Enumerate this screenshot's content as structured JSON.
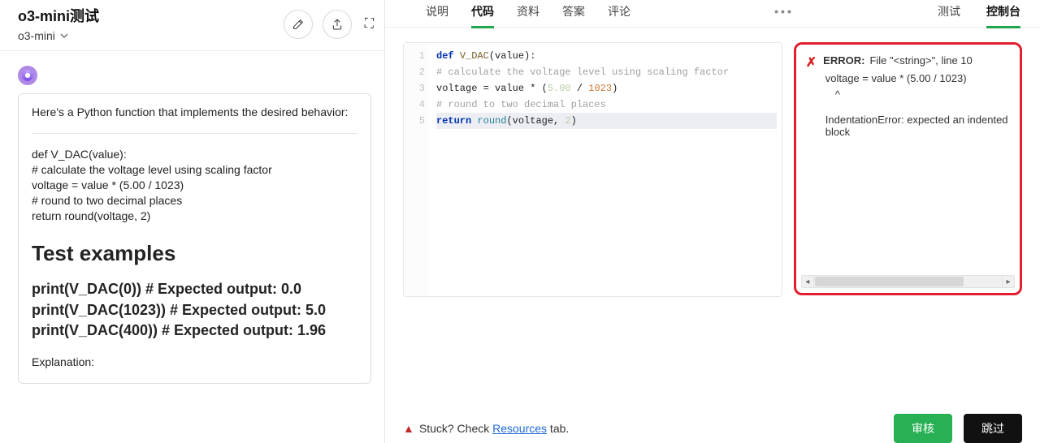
{
  "left": {
    "title": "o3-mini测试",
    "subtitle": "o3-mini",
    "card_intro": "Here's a Python function that implements the desired behavior:",
    "card_code": "def V_DAC(value):\n# calculate the voltage level using scaling factor\nvoltage = value * (5.00 / 1023)\n# round to two decimal places\nreturn round(voltage, 2)",
    "section_heading": "Test examples",
    "examples": "print(V_DAC(0)) # Expected output: 0.0\nprint(V_DAC(1023)) # Expected output: 5.0\nprint(V_DAC(400)) # Expected output: 1.96",
    "more": "Explanation:"
  },
  "tabs_left": {
    "items": [
      "说明",
      "代码",
      "资料",
      "答案",
      "评论"
    ],
    "active": 1
  },
  "tabs_right": {
    "items": [
      "测试",
      "控制台"
    ],
    "active": 1
  },
  "editor": {
    "lines": [
      {
        "n": 1,
        "seg": [
          [
            "kw",
            "def "
          ],
          [
            "fn",
            "V_DAC"
          ],
          [
            "pln",
            "(value):"
          ]
        ]
      },
      {
        "n": 2,
        "seg": [
          [
            "com",
            "# calculate the voltage level using scaling factor"
          ]
        ]
      },
      {
        "n": 3,
        "seg": [
          [
            "pln",
            "voltage = value * ("
          ],
          [
            "num",
            "5.00"
          ],
          [
            "pln",
            " / "
          ],
          [
            "num2",
            "1023"
          ],
          [
            "pln",
            ")"
          ]
        ]
      },
      {
        "n": 4,
        "seg": [
          [
            "com",
            "# round to two decimal places"
          ]
        ]
      },
      {
        "n": 5,
        "seg": [
          [
            "kw",
            "return "
          ],
          [
            "fn2",
            "round"
          ],
          [
            "pln",
            "(voltage, "
          ],
          [
            "num",
            "2"
          ],
          [
            "pln",
            ")"
          ]
        ],
        "hl": true
      }
    ]
  },
  "console": {
    "label": "ERROR:",
    "line1": "File \"<string>\", line 10",
    "line2": "voltage = value * (5.00 / 1023)",
    "caret": "^",
    "msg": "IndentationError: expected an indented block"
  },
  "footer": {
    "stuck_pre": "Stuck? Check ",
    "stuck_link": "Resources",
    "stuck_post": " tab.",
    "green": "审核",
    "black": "跳过"
  }
}
